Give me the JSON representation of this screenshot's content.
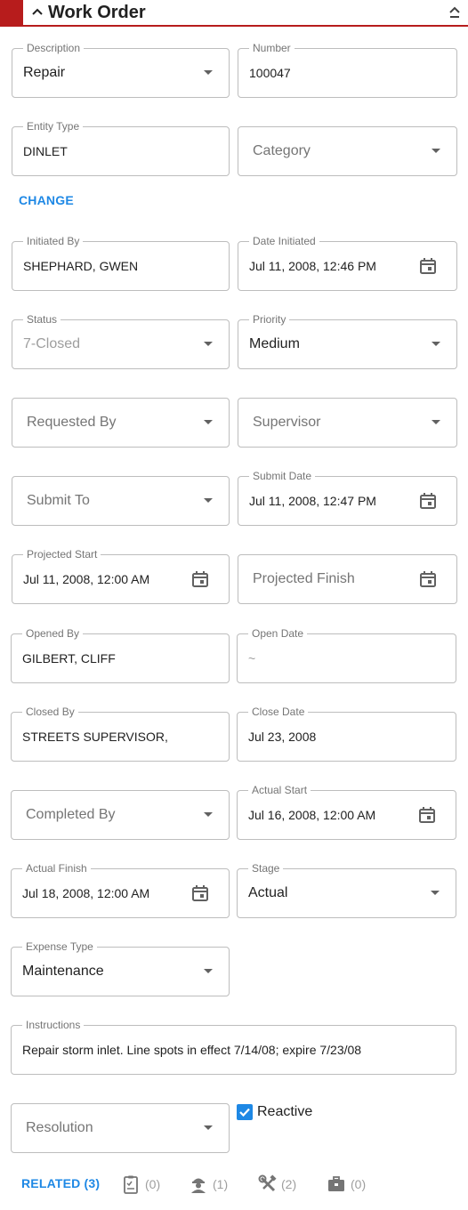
{
  "header": {
    "title": "Work Order"
  },
  "form": {
    "description": {
      "label": "Description",
      "value": "Repair"
    },
    "number": {
      "label": "Number",
      "value": "100047"
    },
    "entity_type": {
      "label": "Entity Type",
      "value": "DINLET"
    },
    "category": {
      "placeholder": "Category"
    },
    "change_label": "CHANGE",
    "initiated_by": {
      "label": "Initiated By",
      "value": "SHEPHARD, GWEN"
    },
    "date_initiated": {
      "label": "Date Initiated",
      "value": "Jul 11, 2008, 12:46 PM"
    },
    "status": {
      "label": "Status",
      "value": "7-Closed"
    },
    "priority": {
      "label": "Priority",
      "value": "Medium"
    },
    "requested_by": {
      "placeholder": "Requested By"
    },
    "supervisor": {
      "placeholder": "Supervisor"
    },
    "submit_to": {
      "placeholder": "Submit To"
    },
    "submit_date": {
      "label": "Submit Date",
      "value": "Jul 11, 2008, 12:47 PM"
    },
    "projected_start": {
      "label": "Projected Start",
      "value": "Jul 11, 2008, 12:00 AM"
    },
    "projected_finish": {
      "placeholder": "Projected Finish"
    },
    "opened_by": {
      "label": "Opened By",
      "value": "GILBERT, CLIFF"
    },
    "open_date": {
      "label": "Open Date",
      "value": "~"
    },
    "closed_by": {
      "label": "Closed By",
      "value": "STREETS SUPERVISOR,"
    },
    "close_date": {
      "label": "Close Date",
      "value": "Jul 23, 2008"
    },
    "completed_by": {
      "placeholder": "Completed By"
    },
    "actual_start": {
      "label": "Actual Start",
      "value": "Jul 16, 2008, 12:00 AM"
    },
    "actual_finish": {
      "label": "Actual Finish",
      "value": "Jul 18, 2008, 12:00 AM"
    },
    "stage": {
      "label": "Stage",
      "value": "Actual"
    },
    "expense_type": {
      "label": "Expense Type",
      "value": "Maintenance"
    },
    "instructions": {
      "label": "Instructions",
      "value": "Repair storm inlet. Line spots in effect 7/14/08; expire 7/23/08"
    },
    "resolution": {
      "placeholder": "Resolution"
    },
    "reactive": {
      "label": "Reactive",
      "checked": true
    }
  },
  "related": {
    "label": "RELATED (3)",
    "items": [
      {
        "icon": "clipboard-icon",
        "count": "(0)"
      },
      {
        "icon": "worker-icon",
        "count": "(1)"
      },
      {
        "icon": "tools-icon",
        "count": "(2)"
      },
      {
        "icon": "toolbox-icon",
        "count": "(0)"
      }
    ]
  },
  "colors": {
    "accent": "#b71c1c",
    "link": "#1e88e5",
    "border": "#bdbdbd"
  }
}
